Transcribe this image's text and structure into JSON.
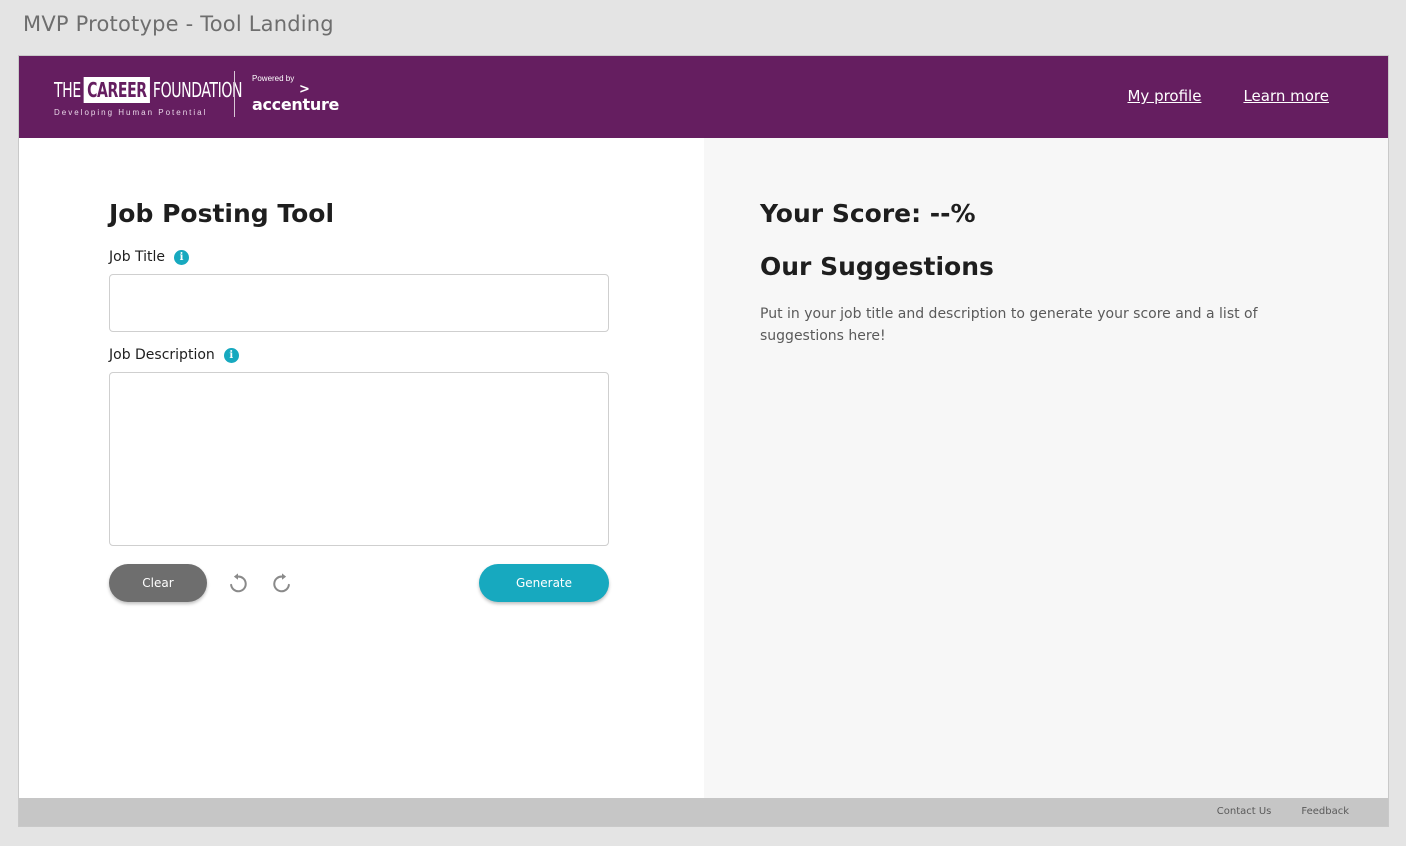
{
  "frame": {
    "title": "MVP Prototype - Tool Landing"
  },
  "header": {
    "logo": {
      "the": "THE",
      "career": "CAREER",
      "foundation": "FOUNDATION",
      "tagline": "Developing Human Potential"
    },
    "powered_by": "Powered by",
    "partner_chevron": ">",
    "partner": "accenture",
    "nav": {
      "profile": "My profile",
      "learn_more": "Learn more"
    },
    "color": "#651e60"
  },
  "tool": {
    "title": "Job Posting Tool",
    "job_title_label": "Job Title",
    "job_title_value": "",
    "job_description_label": "Job Description",
    "job_description_value": "",
    "info_glyph": "i",
    "clear_label": "Clear",
    "generate_label": "Generate",
    "accent_color": "#17a9bf"
  },
  "results": {
    "score": "Your Score: --%",
    "suggestions_title": "Our Suggestions",
    "suggestions_body": "Put in your job title and description to generate your score and a list of suggestions here!"
  },
  "footer": {
    "contact": "Contact Us",
    "feedback": "Feedback"
  }
}
